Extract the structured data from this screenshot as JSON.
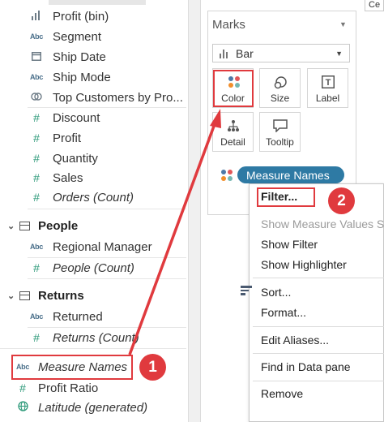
{
  "data_pane": {
    "fields_top": [
      {
        "icon": "bin-icon",
        "label": "Profit (bin)",
        "italic": false
      },
      {
        "icon": "abc",
        "label": "Segment",
        "italic": false
      },
      {
        "icon": "calendar-icon",
        "label": "Ship Date",
        "italic": false
      },
      {
        "icon": "abc",
        "label": "Ship Mode",
        "italic": false
      },
      {
        "icon": "set-icon",
        "label": "Top Customers by Pro...",
        "italic": false
      },
      {
        "icon": "hash",
        "label": "Discount",
        "italic": false
      },
      {
        "icon": "hash",
        "label": "Profit",
        "italic": false
      },
      {
        "icon": "hash",
        "label": "Quantity",
        "italic": false
      },
      {
        "icon": "hash",
        "label": "Sales",
        "italic": false
      },
      {
        "icon": "hash",
        "label": "Orders (Count)",
        "italic": true
      }
    ],
    "people_header": "People",
    "people_fields": [
      {
        "icon": "abc",
        "label": "Regional Manager",
        "italic": false
      },
      {
        "icon": "hash",
        "label": "People (Count)",
        "italic": true
      }
    ],
    "returns_header": "Returns",
    "returns_fields": [
      {
        "icon": "abc",
        "label": "Returned",
        "italic": false
      },
      {
        "icon": "hash",
        "label": "Returns (Count)",
        "italic": true
      }
    ],
    "bottom_fields": [
      {
        "icon": "abc",
        "label": "Measure Names",
        "italic": true
      },
      {
        "icon": "hash",
        "label": "Profit Ratio",
        "italic": false
      },
      {
        "icon": "globe-icon",
        "label": "Latitude (generated)",
        "italic": true
      }
    ],
    "abc_glyph": "Abc",
    "hash_glyph": "#"
  },
  "marks": {
    "title": "Marks",
    "mark_type": "Bar",
    "buttons": {
      "color": "Color",
      "size": "Size",
      "label": "Label",
      "detail": "Detail",
      "tooltip": "Tooltip"
    },
    "label_glyph": "T",
    "pill": "Measure Names",
    "dot_colors": [
      "#4e79a7",
      "#f28e2b",
      "#e15759",
      "#76b7b2"
    ]
  },
  "context_menu": {
    "items": {
      "filter": "Filter...",
      "show_measure_values": "Show Measure Values Sh",
      "show_filter": "Show Filter",
      "show_highlighter": "Show Highlighter",
      "sort": "Sort...",
      "format": "Format...",
      "edit_aliases": "Edit Aliases...",
      "find_in_data_pane": "Find in Data pane",
      "remove": "Remove"
    }
  },
  "callouts": {
    "step1": "1",
    "step2": "2",
    "accent": "#e03a3e"
  },
  "corner_input": "Ce"
}
